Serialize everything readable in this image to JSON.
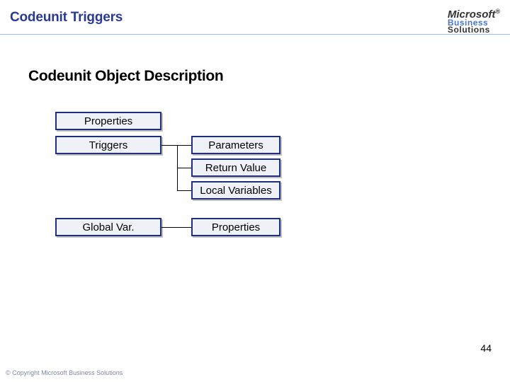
{
  "header": {
    "title": "Codeunit Triggers",
    "logo": {
      "line1": "Microsoft",
      "reg": "®",
      "line2": "Business",
      "line3": "Solutions"
    }
  },
  "subtitle": "Codeunit Object Description",
  "boxes": {
    "properties": "Properties",
    "triggers": "Triggers",
    "global_var": "Global Var.",
    "parameters": "Parameters",
    "return_value": "Return Value",
    "local_variables": "Local Variables",
    "right_properties": "Properties"
  },
  "slide_number": "44",
  "footer": "© Copyright Microsoft Business Solutions"
}
